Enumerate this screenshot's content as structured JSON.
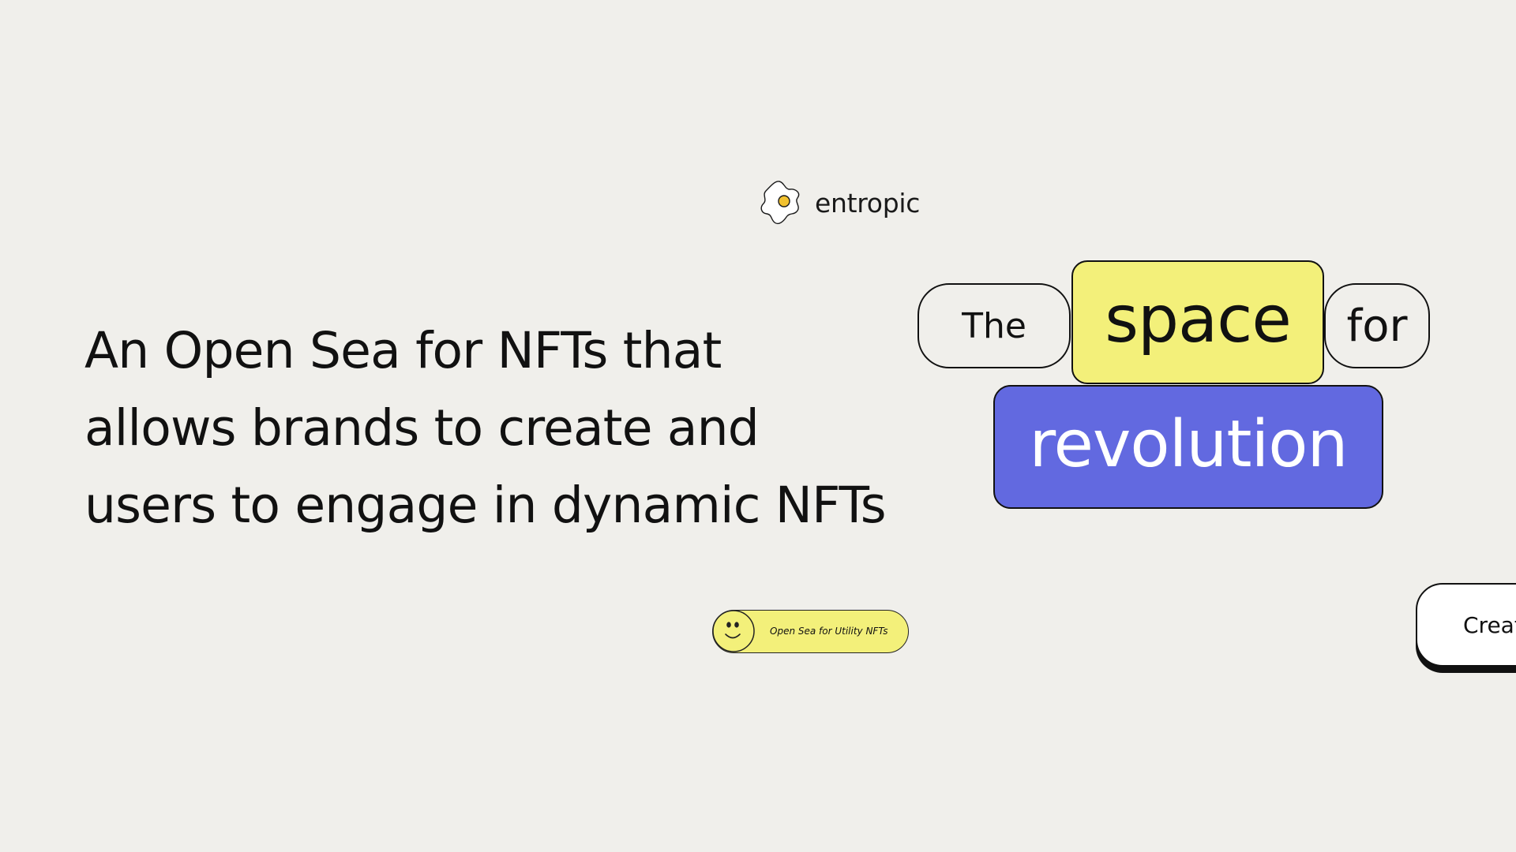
{
  "brand": {
    "name": "entropic",
    "icon": "fried-egg-logo-icon"
  },
  "hero": {
    "headline_lines": [
      "An Open Sea for NFTs that",
      "allows brands to create and",
      "users to engage in dynamic NFTs"
    ]
  },
  "tagline_words": {
    "the": "The",
    "space": "space",
    "for": "for",
    "revolution": "revolution"
  },
  "tag": {
    "label": "Open Sea for Utility NFTs",
    "icon": "smiley-face-icon"
  },
  "cta": {
    "create_label": "Create"
  },
  "colors": {
    "background": "#f0efeb",
    "yellow": "#f3f07a",
    "purple": "#6269e0",
    "text": "#111111",
    "logo_yolk": "#f2c230"
  }
}
